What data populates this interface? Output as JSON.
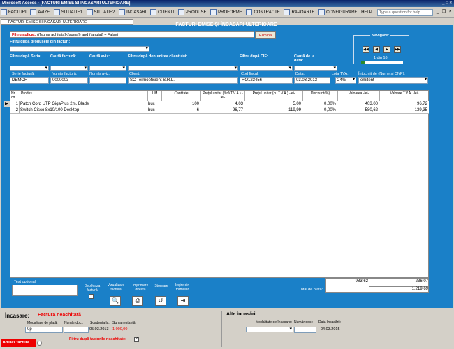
{
  "window": {
    "title": "Microsoft Access - [FACTURI EMISE SI INCASARI ULTERIOARE]"
  },
  "menu": [
    "FACTURI",
    "AVIZE",
    "SITUATIE1",
    "SITUATIE2",
    "INCASARI",
    "CLIENTI",
    "PRODUSE",
    "PROFORME",
    "CONTRACTE",
    "RAPOARTE",
    "CONFIGURARE",
    "HELP"
  ],
  "help_placeholder": "Type a question for help",
  "doctab": "FACTURI EMISE SI INCASARI ULTERIOARE",
  "header": "FACTURI EMISE ȘI ÎNCASARI ULTERIOARE",
  "filter": {
    "label": "Filtru aplicat:",
    "value": "(([suma achitata]<[suma]) and ([anulat] = False)",
    "button": "Elimina"
  },
  "labels": {
    "filtru_produse": "Filtru după produsele din facturi:",
    "filtru_seria": "Filtru după Seria:",
    "cauta_factura": "Caută factură:",
    "cauta_aviz": "Caută aviz:",
    "filtru_client": "Filtru după denumirea clientului:",
    "filtru_cif": "Filtru după CIF:",
    "cauta_data": "Caută de la data:",
    "navigare": "Navigare:",
    "nav_pos": "1",
    "nav_din": "din",
    "nav_total": "16"
  },
  "invoice": {
    "serie_lbl": "Serie factură:",
    "serie": "DEMOF",
    "numar_lbl": "Număr factură:",
    "numar": "0000003",
    "aviz_lbl": "Număr aviz:",
    "aviz": "",
    "client_lbl": "Client:",
    "client": "SC Termoeficient S.R.L.",
    "cif_lbl": "Cod fiscal:",
    "cif": "RO123456",
    "data_lbl": "Data:",
    "data": "03.03.2013",
    "tva_lbl": "cota TVA:",
    "tva": "24%",
    "intocmit_lbl": "Întocmit de (Nume si CNP):",
    "intocmit": "emitent"
  },
  "table": {
    "headers": [
      "Nr. crt.",
      "Produs",
      "UM",
      "Cantitate",
      "Prețul unitar (fără T.V.A.) -lei-",
      "Prețul unitar (cu T.V.A.) -lei-",
      "Discount(%)",
      "Valoarea -lei-",
      "Valoare T.V.A. -lei-"
    ],
    "rows": [
      [
        "1",
        "Patch Cord UTP GigaPlus 2m, Blade",
        "buc",
        "100",
        "4,03",
        "5,00",
        "0,00%",
        "403,00",
        "96,72"
      ],
      [
        "2",
        "Switch Cisco 8x10/100 Desktop",
        "buc",
        "6",
        "96,77",
        "119,99",
        "0,00%",
        "580,62",
        "139,35"
      ]
    ]
  },
  "totals": {
    "valoare": "983,62",
    "tva": "236,07",
    "total_lbl": "Total de plată:",
    "total": "1.219,69"
  },
  "actions": {
    "text_optional": "Text opțional:",
    "debifeaza": "Debifeaza factură",
    "vizualizare": "Vizualizare factură",
    "imprimare": "Imprimare directă",
    "stornare": "Stornare",
    "iesire": "Ieșire din formular"
  },
  "incasare": {
    "title": "Încasare:",
    "status": "Factura neachitată",
    "mod_lbl": "Modalitate de plată:",
    "doc_lbl": "Număr doc.:",
    "scadenta_lbl": "Scadenta la:",
    "rest_lbl": "Suma restantă",
    "mod": "0p",
    "scadenta": "05.03.2013",
    "rest": "1.000,00",
    "filtru_neachitate": "Filtru după facturile neachitate:"
  },
  "alte": {
    "title": "Alte încasări:",
    "mod_lbl": "Modalitate de încasare:",
    "doc_lbl": "Număr doc.:",
    "data_lbl": "Data încasării:",
    "data": "04.03.2015"
  },
  "anuleaza": "Anulez factura",
  "colors": {
    "main_bg": "#1a80c8",
    "status_red": "#e00000"
  }
}
